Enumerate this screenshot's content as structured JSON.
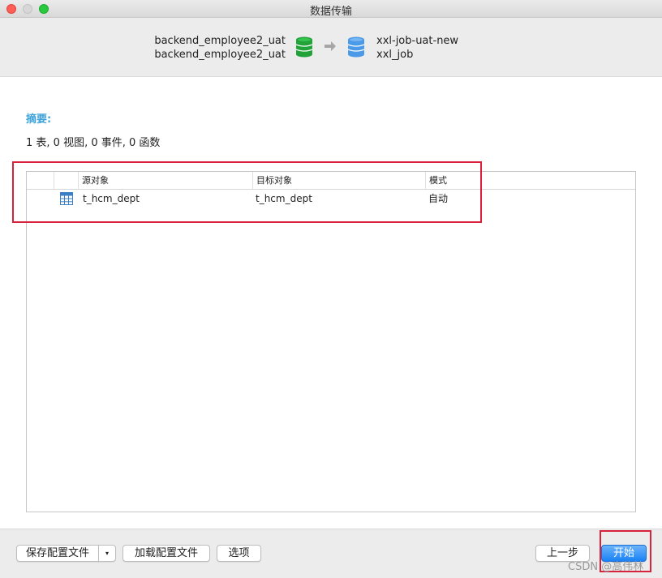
{
  "window": {
    "title": "数据传输"
  },
  "transfer": {
    "source": {
      "connection": "backend_employee2_uat",
      "database": "backend_employee2_uat",
      "icon": "database-icon",
      "color": "#22a33a"
    },
    "target": {
      "connection": "xxl-job-uat-new",
      "database": "xxl_job",
      "icon": "database-icon",
      "color": "#4a9ae8"
    },
    "arrow_icon": "arrow-right-icon"
  },
  "summary": {
    "label": "摘要:",
    "text": "1 表, 0 视图, 0 事件, 0 函数"
  },
  "table": {
    "columns": [
      "",
      "",
      "源对象",
      "目标对象",
      "模式"
    ],
    "rows": [
      {
        "icon": "table-icon",
        "source": "t_hcm_dept",
        "target": "t_hcm_dept",
        "mode": "自动"
      }
    ]
  },
  "footer": {
    "save_config": "保存配置文件",
    "save_dropdown": "▾",
    "load_config": "加载配置文件",
    "options": "选项",
    "previous": "上一步",
    "start": "开始"
  },
  "watermark": "CSDN @高伟林",
  "colors": {
    "accent": "#3ea3d8",
    "annotation": "#d8213b",
    "primary_button": "#1a82f5"
  }
}
